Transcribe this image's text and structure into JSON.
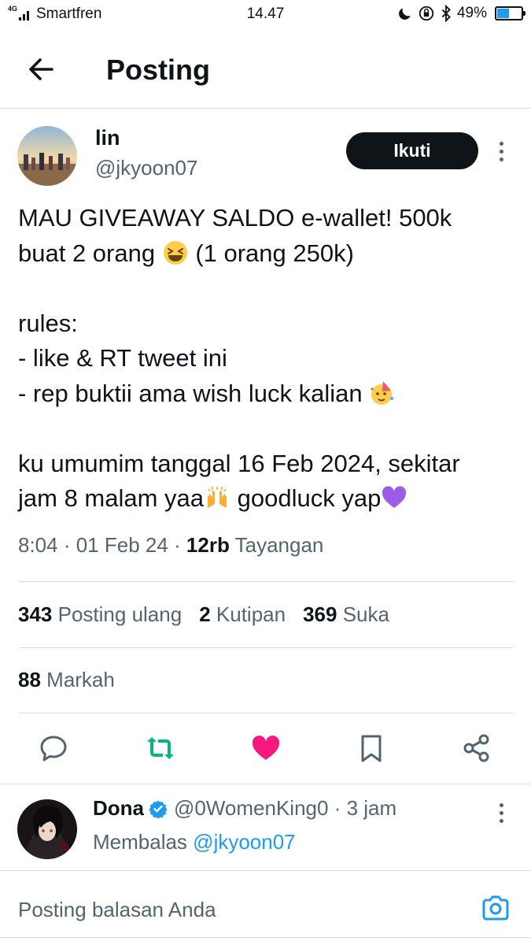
{
  "status_bar": {
    "network_type": "4G",
    "carrier": "Smartfren",
    "time": "14.47",
    "battery": "49%",
    "battery_level": 0.49
  },
  "header": {
    "back_icon": "arrow-left-icon",
    "title": "Posting"
  },
  "tweet": {
    "author_name": "lin",
    "author_handle": "@jkyoon07",
    "follow_label": "Ikuti",
    "text": {
      "l1": "MAU GIVEAWAY SALDO e-wallet! 500k",
      "l2a": "buat 2 orang ",
      "l2b": " (1 orang 250k)",
      "l4": "rules:",
      "l5": "- like & RT tweet ini",
      "l6": "- rep buktii ama wish luck kalian ",
      "l8": "ku umumim tanggal 16 Feb 2024, sekitar",
      "l9a": "jam 8 malam yaa",
      "l9b": " goodluck yap"
    },
    "time": "8:04",
    "date": "01 Feb 24",
    "views_count": "12rb",
    "views_label": "Tayangan",
    "reposts_count": "343",
    "reposts_label": "Posting ulang",
    "quotes_count": "2",
    "quotes_label": "Kutipan",
    "likes_count": "369",
    "likes_label": "Suka",
    "bookmarks_count": "88",
    "bookmarks_label": "Markah"
  },
  "actions": {
    "reply_icon": "comment-icon",
    "repost_icon": "repost-icon",
    "like_icon": "heart-icon",
    "bookmark_icon": "bookmark-icon",
    "share_icon": "share-icon"
  },
  "reply": {
    "author_name": "Dona",
    "author_handle": "@0WomenKing0",
    "time_ago": "3 jam",
    "replying_to_label": "Membalas",
    "replying_to_handle": "@jkyoon07"
  },
  "compose": {
    "placeholder": "Posting balasan Anda",
    "camera_icon": "camera-icon"
  },
  "colors": {
    "accent": "#1d9bf0",
    "repost_green": "#00ba7c",
    "like_pink": "#f91880",
    "text_secondary": "#536471",
    "divider": "#d9dee2"
  }
}
